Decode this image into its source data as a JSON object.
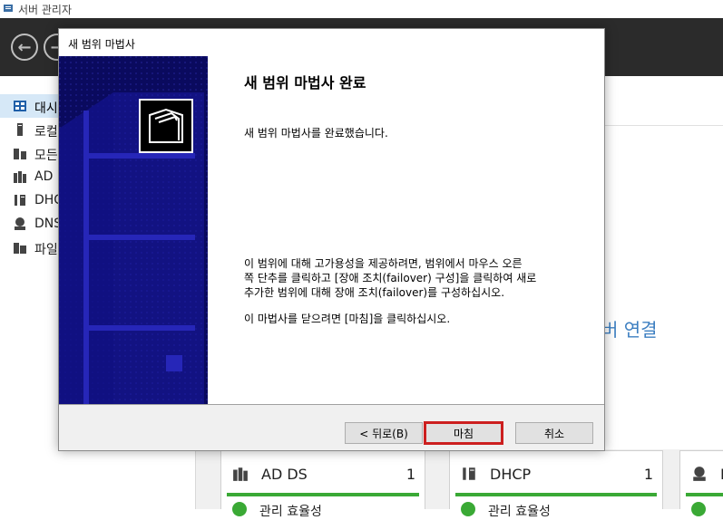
{
  "app": {
    "title": "서버 관리자",
    "icon": "server-manager-icon"
  },
  "nav": {
    "items": [
      {
        "label": "대시",
        "icon": "dashboard-icon",
        "selected": true
      },
      {
        "label": "로컬",
        "icon": "local-server-icon"
      },
      {
        "label": "모든",
        "icon": "all-servers-icon"
      },
      {
        "label": "AD",
        "icon": "ad-ds-icon"
      },
      {
        "label": "DHC",
        "icon": "dhcp-icon"
      },
      {
        "label": "DNS",
        "icon": "dns-icon"
      },
      {
        "label": "파일",
        "icon": "file-services-icon"
      }
    ]
  },
  "main": {
    "connect_link": "버 연결",
    "tiles": [
      {
        "name": "AD DS",
        "count": "1",
        "status": "관리 효율성",
        "icon": "ad-ds-icon"
      },
      {
        "name": "DHCP",
        "count": "1",
        "status": "관리 효율성",
        "icon": "dhcp-icon"
      },
      {
        "name": "D",
        "count": "",
        "status": "",
        "icon": "dns-icon"
      }
    ],
    "status_color": "#3aa935"
  },
  "wizard": {
    "title": "새 범위 마법사",
    "heading": "새 범위 마법사 완료",
    "done_text": "새 범위 마법사를 완료했습니다.",
    "failover_lines": [
      "이 범위에 대해 고가용성을 제공하려면, 범위에서 마우스 오른",
      "쪽 단추를 클릭하고 [장애 조치(failover) 구성]을 클릭하여 새로",
      "추가한 범위에 대해 장애 조치(failover)를 구성하십시오."
    ],
    "close_text": "이 마법사를 닫으려면 [마침]을 클릭하십시오.",
    "buttons": {
      "back": "< 뒤로(B)",
      "finish": "마침",
      "cancel": "취소"
    },
    "side_color": "#0a0a5e",
    "highlight_color": "#cc1f1f"
  }
}
